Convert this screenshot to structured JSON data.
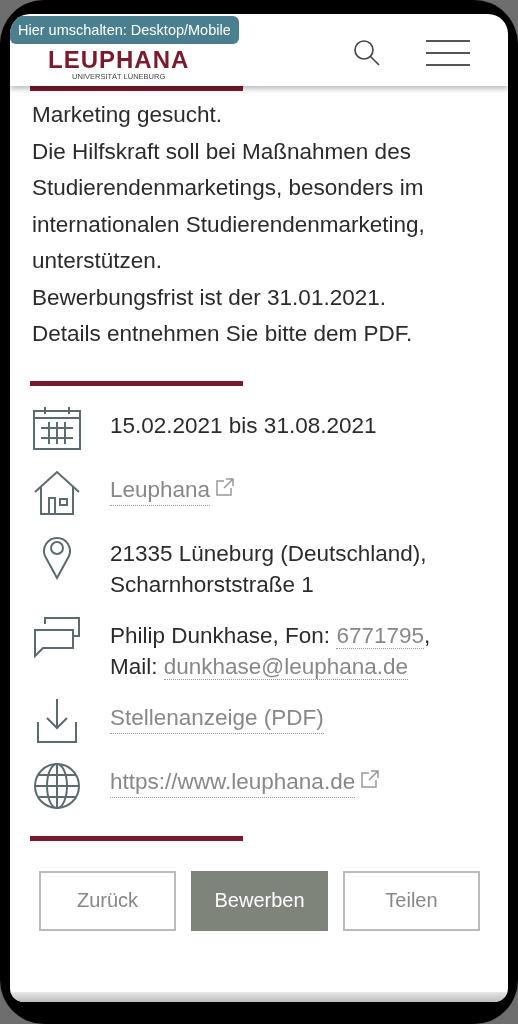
{
  "switch_tooltip": "Hier umschalten: Desktop/Mobile",
  "logo": {
    "name": "LEUPHANA",
    "subtitle": "UNIVERSITÄT LÜNEBURG"
  },
  "description": [
    "Marketing gesucht.",
    "Die Hilfskraft soll bei Maßnahmen des",
    "Studierendenmarketings, besonders im",
    "internationalen Studierendenmarketing,",
    "unterstützen.",
    "Bewerbungsfrist ist der 31.01.2021.",
    "Details entnehmen Sie bitte dem PDF."
  ],
  "details": [
    {
      "kind": "date",
      "parts": [
        {
          "text": "15.02.2021 bis 31.08.2021",
          "link": false
        }
      ]
    },
    {
      "kind": "institution",
      "external": true,
      "parts": [
        {
          "text": "Leuphana",
          "link": true
        }
      ]
    },
    {
      "kind": "location",
      "parts": [
        {
          "text": "21335 Lüneburg (Deutschland), Scharnhorststraße 1",
          "link": false
        }
      ]
    },
    {
      "kind": "contact",
      "parts": [
        {
          "text": "Philip Dunkhase, Fon: ",
          "link": false
        },
        {
          "text": "6771795",
          "link": true
        },
        {
          "text": ", Mail: ",
          "link": false
        },
        {
          "text": "dunkhase@leuphana.de",
          "link": true
        }
      ]
    },
    {
      "kind": "download",
      "parts": [
        {
          "text": "Stellenanzeige (PDF)",
          "link": true
        }
      ]
    },
    {
      "kind": "web",
      "external": true,
      "parts": [
        {
          "text": "https://www.leuphana.de",
          "link": true
        }
      ]
    }
  ],
  "buttons": [
    {
      "label": "Zurück",
      "primary": false
    },
    {
      "label": "Bewerben",
      "primary": true
    },
    {
      "label": "Teilen",
      "primary": false
    }
  ]
}
